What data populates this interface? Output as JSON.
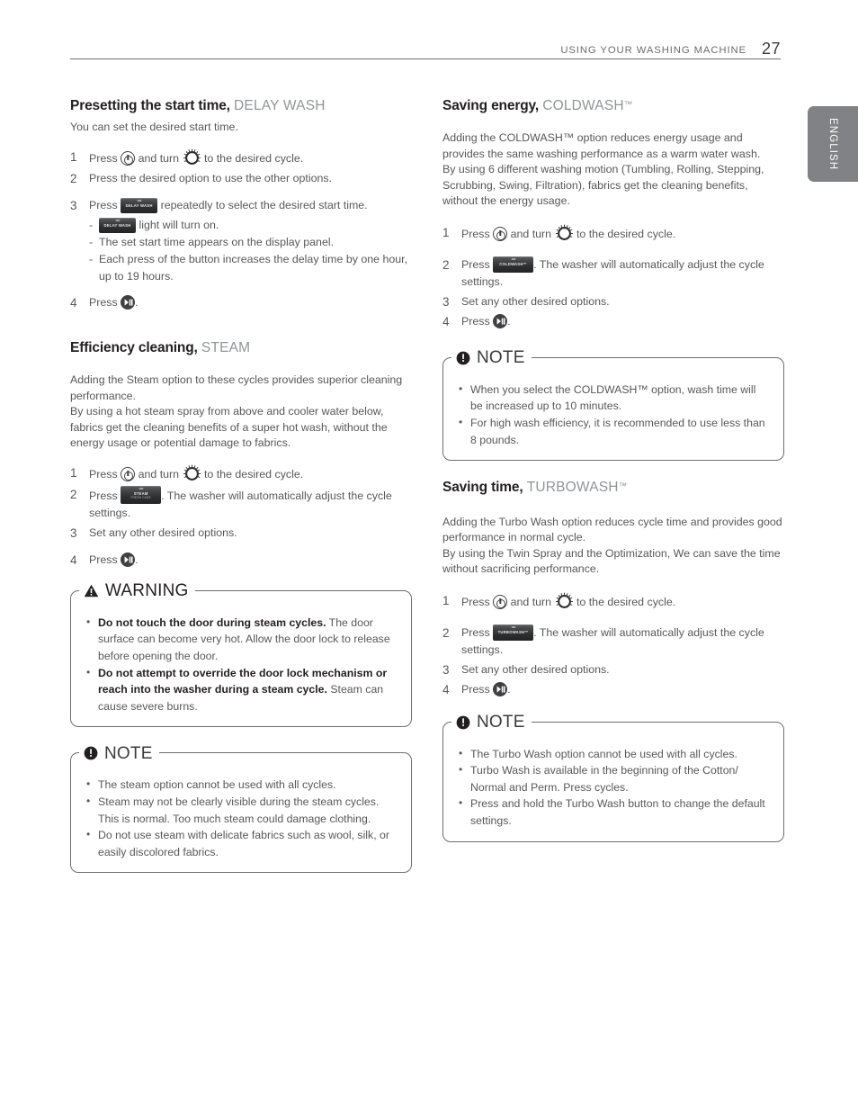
{
  "header": {
    "title": "USING YOUR WASHING MACHINE",
    "page_number": "27"
  },
  "language_tab": {
    "label": "ENGLISH"
  },
  "icons": {
    "power": "power-button-icon",
    "dial": "cycle-dial-icon",
    "play_pause": "start-pause-icon"
  },
  "buttons": {
    "delay_wash": {
      "line1": "DELAY WASH",
      "line2": ""
    },
    "steam": {
      "line1": "STEAM",
      "line2": "FRESH CARE"
    },
    "coldwash": {
      "line1": "COLDWASH™",
      "line2": ""
    },
    "turbowash": {
      "line1": "TURBOWASH™",
      "line2": ""
    }
  },
  "left_column": {
    "delay_wash": {
      "heading_bold": "Presetting the start time,",
      "heading_light": "DELAY WASH",
      "intro": "You can set the desired start time.",
      "steps": [
        {
          "num": "1",
          "pre": "Press",
          "mid": "and turn",
          "post": "to the desired cycle."
        },
        {
          "num": "2",
          "text": "Press the desired option to use the other options."
        },
        {
          "num": "3",
          "pre": "Press",
          "post": "repeatedly to select the desired start time."
        },
        {
          "num": "4",
          "pre": "Press",
          "post": "."
        }
      ],
      "substeps": [
        {
          "pre": "",
          "post": "light will turn on."
        },
        {
          "text": "The set start time appears on the display panel."
        },
        {
          "text": "Each press of the button increases the delay time by one hour, up to 19 hours."
        }
      ]
    },
    "steam": {
      "heading_bold": "Efficiency cleaning,",
      "heading_light": "STEAM",
      "para1": "Adding the Steam option to these cycles provides superior cleaning performance.",
      "para2": "By using a hot steam spray from above and cooler water below, fabrics get the cleaning benefits of a super hot wash, without the energy usage or potential damage to fabrics.",
      "steps": [
        {
          "num": "1",
          "pre": "Press",
          "mid": "and turn",
          "post": "to the desired cycle."
        },
        {
          "num": "2",
          "pre": "Press",
          "post": ". The washer will automatically adjust the cycle settings."
        },
        {
          "num": "3",
          "text": "Set any other desired options."
        },
        {
          "num": "4",
          "pre": "Press",
          "post": "."
        }
      ]
    },
    "warning": {
      "title": "WARNING",
      "items": [
        {
          "bold": "Do not touch the door during steam cycles.",
          "rest": " The door surface can become very hot. Allow the door lock to release before opening the door."
        },
        {
          "bold": "Do not attempt to override the door lock mechanism or reach into the washer during a steam cycle.",
          "rest": " Steam can cause severe burns."
        }
      ]
    },
    "note": {
      "title": "NOTE",
      "items": [
        "The steam option cannot be used with all cycles.",
        "Steam may not be clearly visible during the steam cycles. This is normal. Too much steam could damage clothing.",
        "Do not use steam with delicate fabrics such as wool, silk, or easily discolored fabrics."
      ]
    }
  },
  "right_column": {
    "coldwash": {
      "heading_bold": "Saving energy,",
      "heading_light": "COLDWASH",
      "heading_tm": "™",
      "para1": "Adding the COLDWASH™ option reduces energy usage and provides the same washing performance as a warm water wash.",
      "para2": "By using 6 different washing motion (Tumbling, Rolling, Stepping, Scrubbing, Swing, Filtration), fabrics get the cleaning benefits, without the energy usage.",
      "steps": [
        {
          "num": "1",
          "pre": "Press",
          "mid": "and turn",
          "post": "to the desired cycle."
        },
        {
          "num": "2",
          "pre": "Press",
          "post": ". The washer will automatically adjust the cycle settings."
        },
        {
          "num": "3",
          "text": "Set any other desired options."
        },
        {
          "num": "4",
          "pre": "Press",
          "post": "."
        }
      ]
    },
    "note_cold": {
      "title": "NOTE",
      "items": [
        "When you select the COLDWASH™ option, wash time will be increased up to 10 minutes.",
        "For high wash efficiency, it is recommended to use less than 8 pounds."
      ]
    },
    "turbowash": {
      "heading_bold": "Saving time,",
      "heading_light": "TURBOWASH",
      "heading_tm": "™",
      "para1": "Adding the Turbo Wash option reduces cycle time and provides good performance in normal cycle.",
      "para2": "By using the Twin Spray and the Optimization, We can save the time without sacrificing performance.",
      "steps": [
        {
          "num": "1",
          "pre": "Press",
          "mid": "and turn",
          "post": "to the desired cycle."
        },
        {
          "num": "2",
          "pre": "Press",
          "post": ". The washer will automatically adjust the cycle settings."
        },
        {
          "num": "3",
          "text": "Set any other desired options."
        },
        {
          "num": "4",
          "pre": "Press",
          "post": "."
        }
      ]
    },
    "note_turbo": {
      "title": "NOTE",
      "items": [
        "The Turbo Wash option cannot be used with all cycles.",
        "Turbo Wash is available in the beginning of the Cotton/ Normal and Perm. Press cycles.",
        "Press and hold the Turbo Wash button to change the default settings."
      ]
    }
  }
}
